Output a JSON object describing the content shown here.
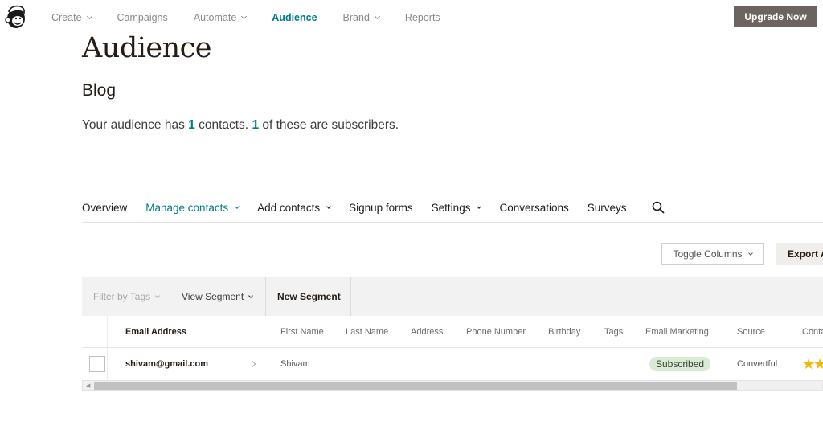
{
  "topnav": {
    "items": [
      {
        "label": "Create",
        "has_dropdown": true,
        "active": false
      },
      {
        "label": "Campaigns",
        "has_dropdown": false,
        "active": false
      },
      {
        "label": "Automate",
        "has_dropdown": true,
        "active": false
      },
      {
        "label": "Audience",
        "has_dropdown": false,
        "active": true
      },
      {
        "label": "Brand",
        "has_dropdown": true,
        "active": false
      },
      {
        "label": "Reports",
        "has_dropdown": false,
        "active": false
      }
    ],
    "upgrade_label": "Upgrade Now",
    "logo_icon": "mailchimp-freddie-logo"
  },
  "page": {
    "title": "Audience",
    "audience_name": "Blog",
    "summary": {
      "prefix": "Your audience has ",
      "contacts": "1",
      "middle": " contacts. ",
      "subscribers": "1",
      "suffix": " of these are subscribers."
    }
  },
  "subnav": {
    "items": [
      {
        "label": "Overview",
        "has_dropdown": false,
        "active": false
      },
      {
        "label": "Manage contacts",
        "has_dropdown": true,
        "active": true
      },
      {
        "label": "Add contacts",
        "has_dropdown": true,
        "active": false
      },
      {
        "label": "Signup forms",
        "has_dropdown": false,
        "active": false
      },
      {
        "label": "Settings",
        "has_dropdown": true,
        "active": false
      },
      {
        "label": "Conversations",
        "has_dropdown": false,
        "active": false
      },
      {
        "label": "Surveys",
        "has_dropdown": false,
        "active": false
      }
    ],
    "search_icon": "search-icon"
  },
  "toolbar": {
    "toggle_columns_label": "Toggle Columns",
    "export_label": "Export Audience"
  },
  "filterbar": {
    "filter_tags_label": "Filter by Tags",
    "view_segment_label": "View Segment",
    "new_segment_label": "New Segment"
  },
  "table": {
    "columns": [
      "Email Address",
      "First Name",
      "Last Name",
      "Address",
      "Phone Number",
      "Birthday",
      "Tags",
      "Email Marketing",
      "Source",
      "Contact Rating"
    ],
    "rows": [
      {
        "email": "shivam@gmail.com",
        "first_name": "Shivam",
        "last_name": "",
        "address": "",
        "phone": "",
        "birthday": "",
        "tags": "",
        "email_marketing": "Subscribed",
        "source": "Convertful",
        "rating_stars": "★★"
      }
    ]
  },
  "colors": {
    "accent": "#007c89",
    "upgrade_button": "#6b6460",
    "subscribed_badge": "#d7ecd0",
    "star": "#f2b705"
  }
}
